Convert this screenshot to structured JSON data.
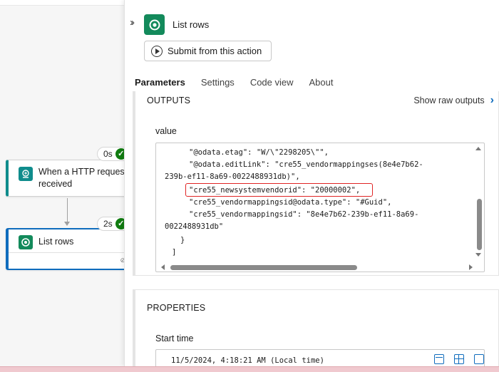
{
  "canvas": {
    "trigger": {
      "title": "When a HTTP request is received",
      "duration": "0s"
    },
    "action": {
      "title": "List rows",
      "duration": "2s"
    }
  },
  "panel": {
    "title": "List rows",
    "submit_label": "Submit from this action",
    "tabs": [
      {
        "label": "Parameters",
        "active": true
      },
      {
        "label": "Settings",
        "active": false
      },
      {
        "label": "Code view",
        "active": false
      },
      {
        "label": "About",
        "active": false
      }
    ],
    "outputs": {
      "header": "OUTPUTS",
      "raw_link": "Show raw outputs",
      "field_label": "value",
      "code_lines": [
        "\"@odata.etag\": \"W/\\\"2298205\\\"\",",
        "\"@odata.editLink\": \"cre55_vendormappingses(8e4e7b62-",
        "239b-ef11-8a69-0022488931db)\",",
        "\"cre55_newsystemvendorid\": \"20000002\",",
        "\"cre55_vendormappingsid@odata.type\": \"#Guid\",",
        "\"cre55_vendormappingsid\": \"8e4e7b62-239b-ef11-8a69-",
        "0022488931db\"",
        "}",
        "]"
      ]
    },
    "properties": {
      "header": "PROPERTIES",
      "start_time_label": "Start time",
      "start_time_value": "11/5/2024, 4:18:21 AM (Local time)"
    }
  },
  "colors": {
    "accent": "#0f6cbd",
    "dataverse_green": "#138a5b",
    "http_teal": "#0f8c8c",
    "success": "#107c10",
    "highlight_red": "#e02424"
  },
  "icons": [
    "collapse-icon",
    "dataverse-icon",
    "http-icon",
    "play-icon",
    "chevron-right-icon",
    "calendar-icon",
    "table-icon",
    "copy-icon",
    "check-icon",
    "link-icon"
  ]
}
